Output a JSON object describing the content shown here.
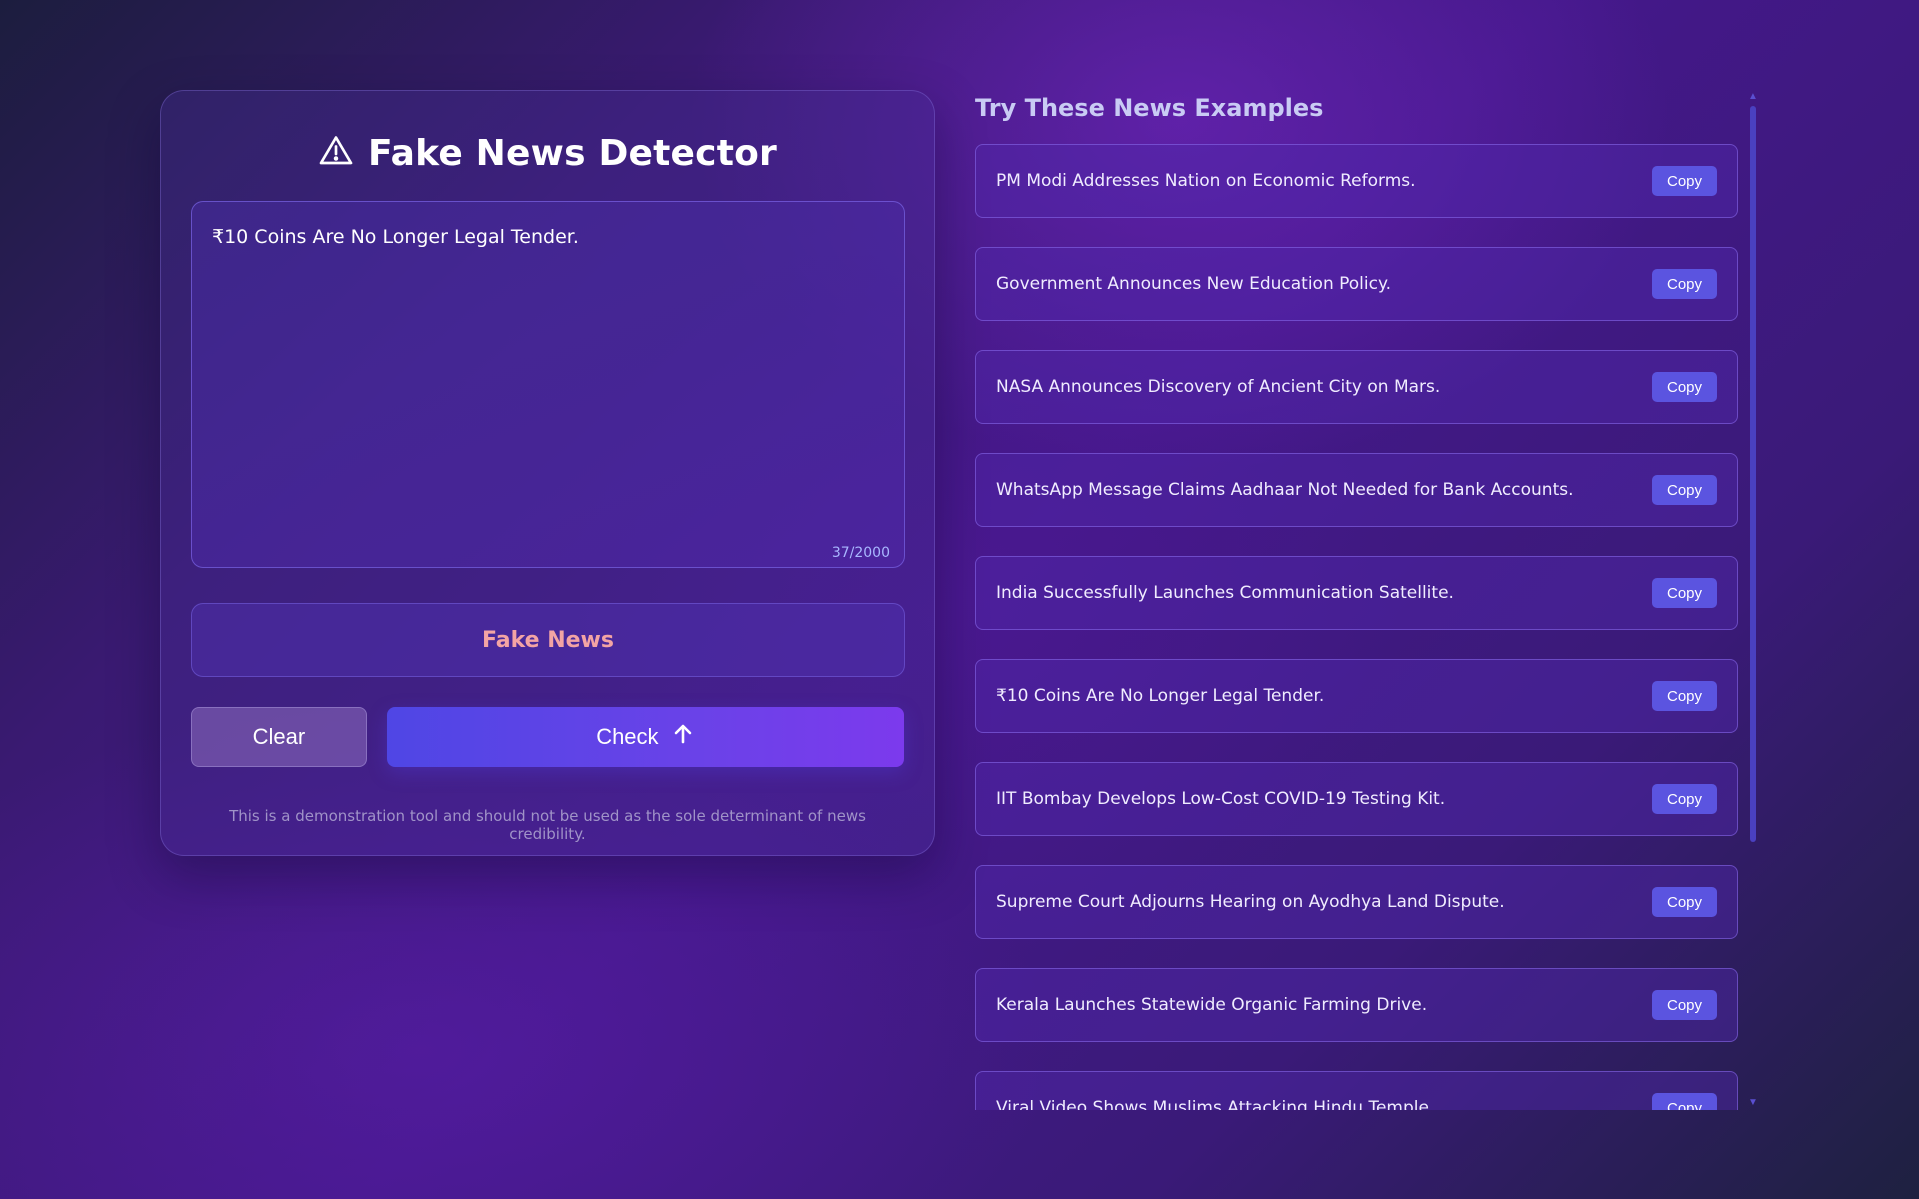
{
  "app": {
    "title": "Fake News Detector",
    "title_icon": "warning-triangle-icon"
  },
  "input": {
    "value": "₹10 Coins Are No Longer Legal Tender.",
    "char_count": "37/2000"
  },
  "result": {
    "label": "Fake News",
    "color": "#f3a4a4"
  },
  "buttons": {
    "clear": "Clear",
    "check": "Check",
    "check_icon": "arrow-up-icon"
  },
  "disclaimer": "This is a demonstration tool and should not be used as the sole determinant of news credibility.",
  "examples": {
    "title": "Try These News Examples",
    "copy_label": "Copy",
    "items": [
      {
        "text": "PM Modi Addresses Nation on Economic Reforms."
      },
      {
        "text": "Government Announces New Education Policy."
      },
      {
        "text": "NASA Announces Discovery of Ancient City on Mars."
      },
      {
        "text": "WhatsApp Message Claims Aadhaar Not Needed for Bank Accounts."
      },
      {
        "text": "India Successfully Launches Communication Satellite."
      },
      {
        "text": "₹10 Coins Are No Longer Legal Tender."
      },
      {
        "text": "IIT Bombay Develops Low-Cost COVID-19 Testing Kit."
      },
      {
        "text": "Supreme Court Adjourns Hearing on Ayodhya Land Dispute."
      },
      {
        "text": "Kerala Launches Statewide Organic Farming Drive."
      },
      {
        "text": "Viral Video Shows Muslims Attacking Hindu Temple."
      }
    ]
  },
  "colors": {
    "accent": "#4f46e5",
    "accent_end": "#7c3aed",
    "copy_button": "#5b54e0"
  }
}
